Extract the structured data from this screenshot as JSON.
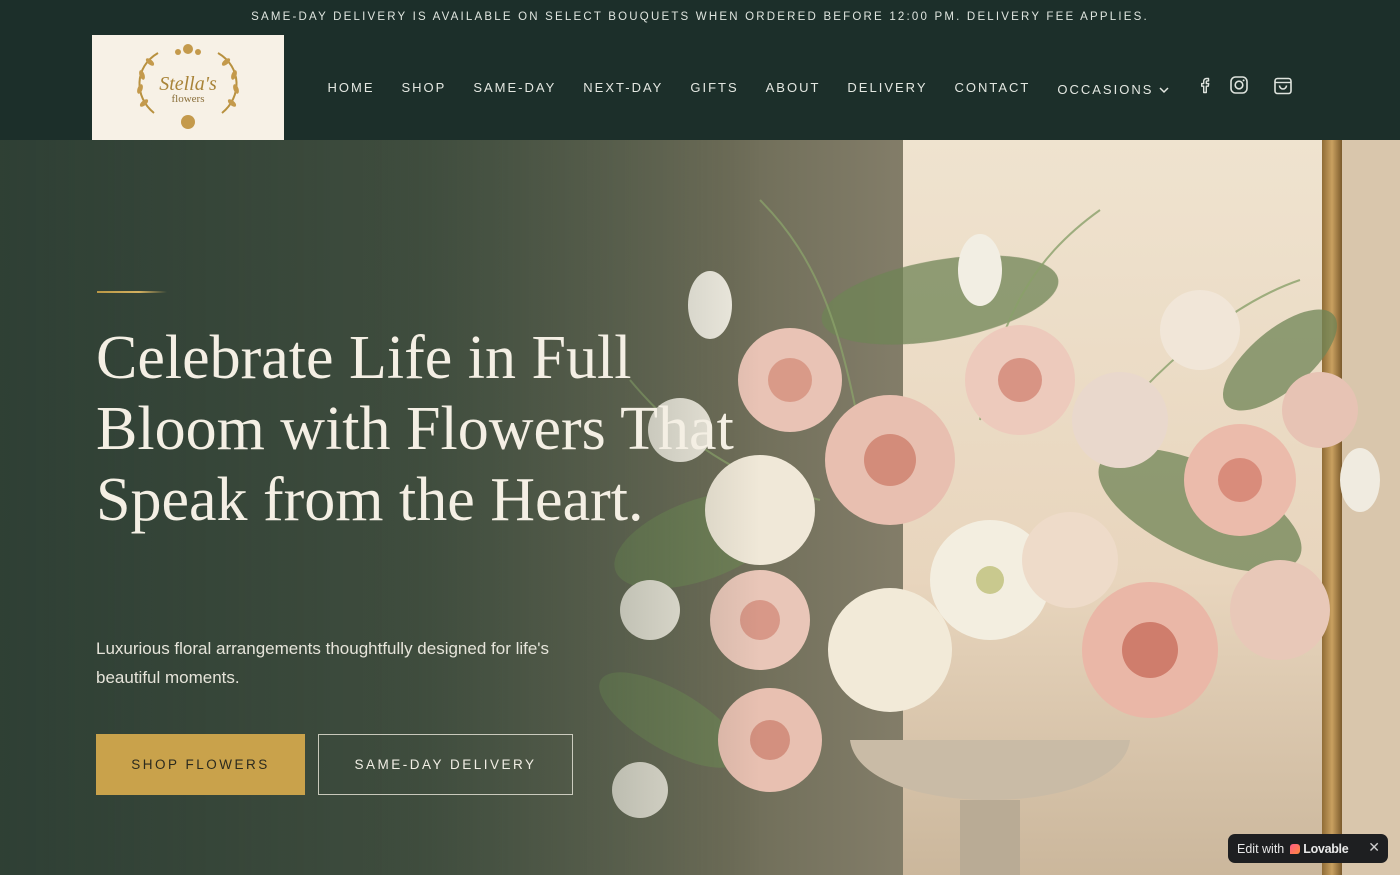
{
  "announcement": "SAME-DAY DELIVERY IS AVAILABLE ON SELECT BOUQUETS WHEN ORDERED BEFORE 12:00 PM. DELIVERY FEE APPLIES.",
  "logo": {
    "line1": "Stella's",
    "line2": "flowers"
  },
  "nav": {
    "items": [
      {
        "label": "HOME"
      },
      {
        "label": "SHOP"
      },
      {
        "label": "SAME-DAY"
      },
      {
        "label": "NEXT-DAY"
      },
      {
        "label": "GIFTS"
      },
      {
        "label": "ABOUT"
      },
      {
        "label": "DELIVERY"
      },
      {
        "label": "CONTACT"
      }
    ],
    "occasions": "OCCASIONS"
  },
  "icons": [
    "facebook-icon",
    "instagram-icon",
    "shopping-bag-icon"
  ],
  "hero": {
    "headline": "Celebrate Life in Full Bloom with Flowers That Speak from the Heart.",
    "subtext": "Luxurious floral arrangements thoughtfully designed for life's beautiful moments.",
    "primary_button": "SHOP FLOWERS",
    "secondary_button": "SAME-DAY DELIVERY"
  },
  "badge": {
    "label": "Edit with",
    "brand": "Lovable",
    "close": "✕"
  },
  "colors": {
    "dark_green": "#1c2f2a",
    "gold": "#c9a24b",
    "cream": "#f4efe4"
  }
}
